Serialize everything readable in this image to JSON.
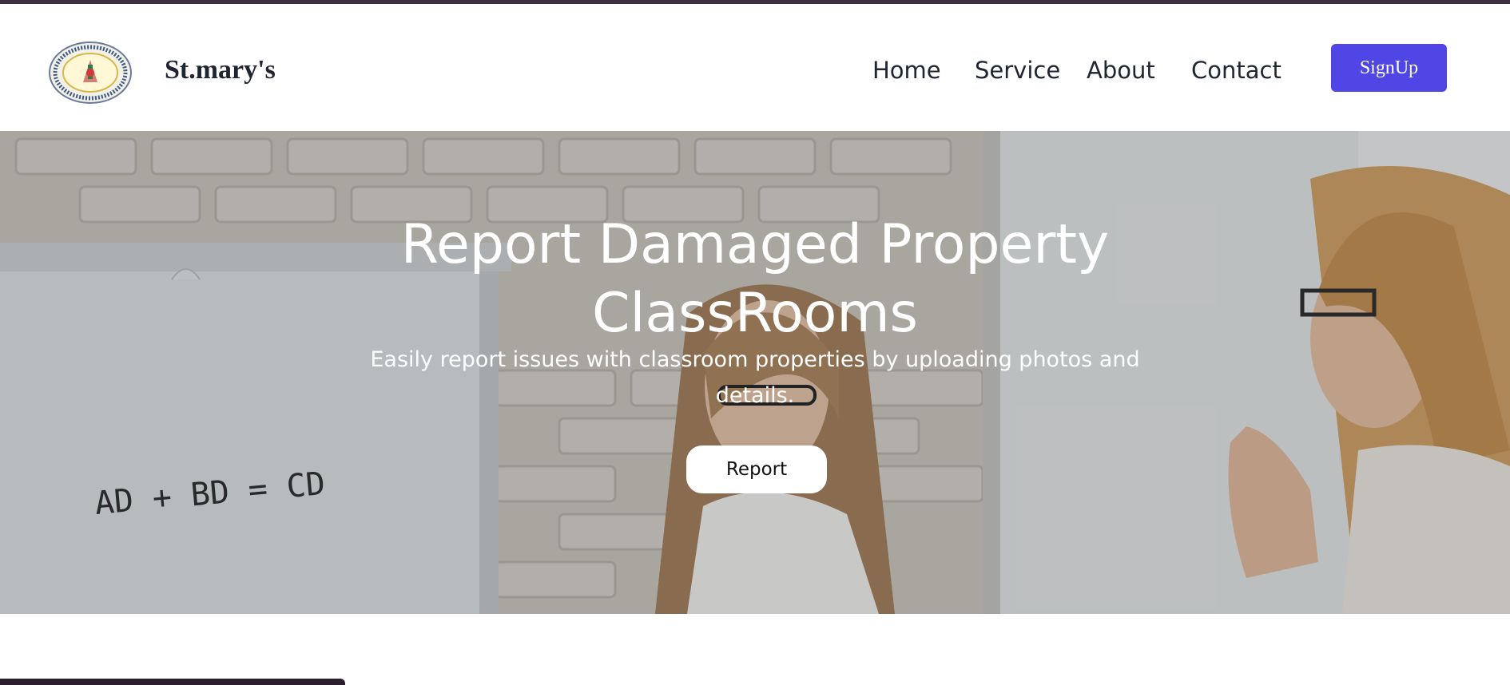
{
  "brand": {
    "name": "St.mary's",
    "logo_icon": "college-seal-logo"
  },
  "nav": {
    "items": [
      {
        "label": "Home"
      },
      {
        "label": "Service"
      },
      {
        "label": "About"
      },
      {
        "label": "Contact"
      }
    ],
    "signup_label": "SignUp"
  },
  "hero": {
    "title_line1": "Report Damaged Property",
    "title_line2": "ClassRooms",
    "subtitle": "Easily report issues with classroom properties by uploading photos and details.",
    "report_label": "Report",
    "whiteboard_text": "AD + BD = CD"
  },
  "colors": {
    "accent": "#4f46e5",
    "top_strip": "#3d2f3f",
    "text_dark": "#1f2633"
  }
}
